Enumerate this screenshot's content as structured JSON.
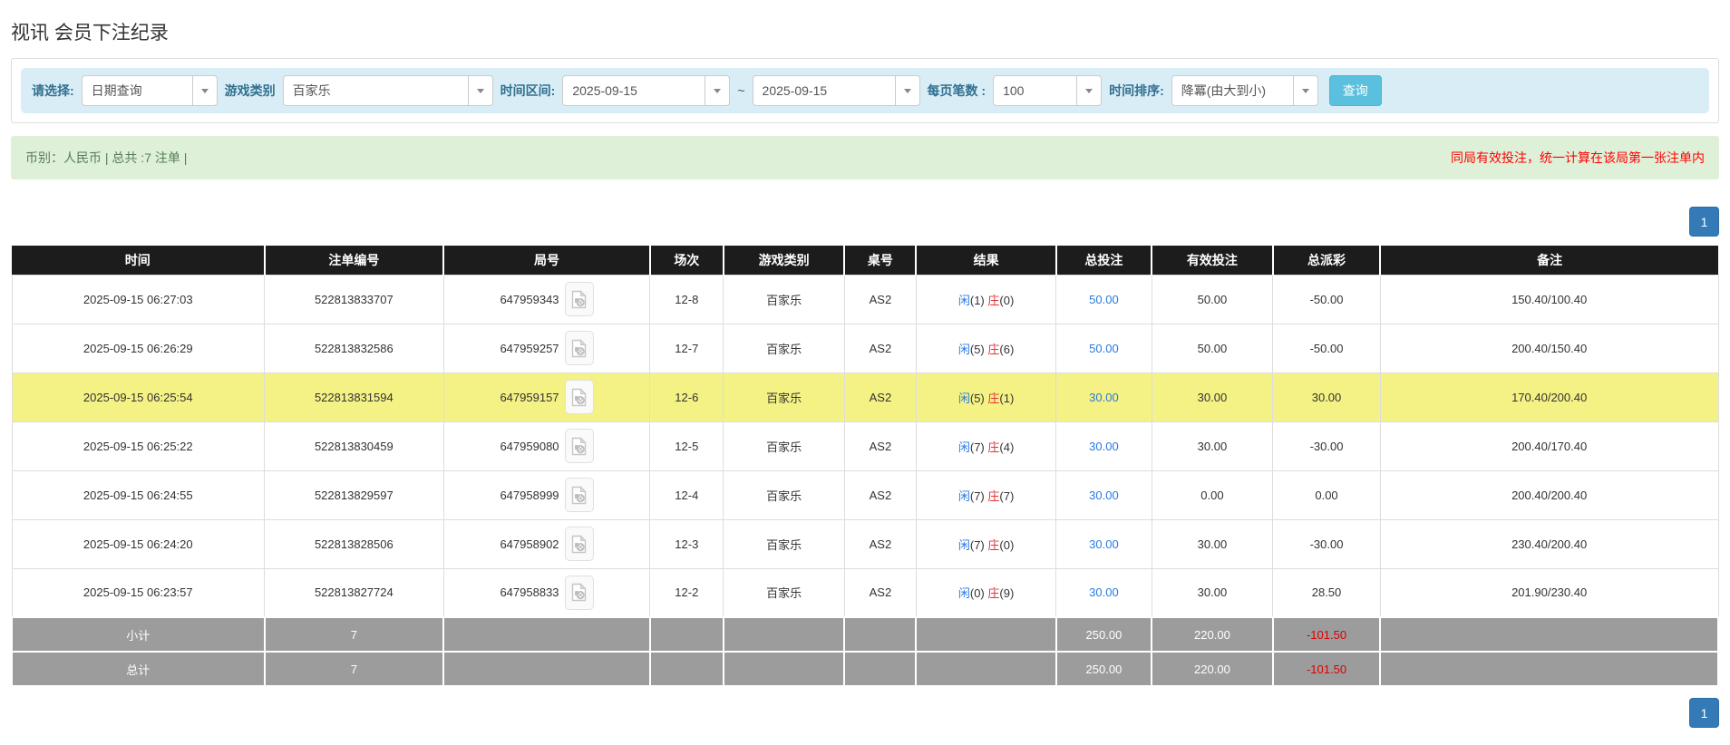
{
  "page": {
    "title": "视讯 会员下注纪录"
  },
  "filters": {
    "query_type": {
      "label": "请选择:",
      "value": "日期查询"
    },
    "game_category": {
      "label": "游戏类别",
      "value": "百家乐"
    },
    "time_range": {
      "label": "时间区间:",
      "from": "2025-09-15",
      "tilde": "~",
      "to": "2025-09-15"
    },
    "page_size": {
      "label": "每页笔数 :",
      "value": "100"
    },
    "time_sort": {
      "label": "时间排序:",
      "value": "降冪(由大到小)"
    },
    "search_button": "查询"
  },
  "summary": {
    "left": "币别：人民币 | 总共 :7 注单 |",
    "right_notice": "同局有效投注，统一计算在该局第一张注单内"
  },
  "pagination": {
    "current_page": "1"
  },
  "table": {
    "headers": [
      "时间",
      "注单编号",
      "局号",
      "场次",
      "游戏类别",
      "桌号",
      "结果",
      "总投注",
      "有效投注",
      "总派彩",
      "备注"
    ],
    "rows": [
      {
        "time": "2025-09-15 06:27:03",
        "bet_id": "522813833707",
        "round_id": "647959343",
        "session": "12-8",
        "game": "百家乐",
        "table_no": "AS2",
        "player_label": "闲",
        "player_value": "(1)",
        "banker_label": "庄",
        "banker_value": "(0)",
        "total_bet": "50.00",
        "valid_bet": "50.00",
        "payout": "-50.00",
        "remark": "150.40/100.40",
        "highlight": false
      },
      {
        "time": "2025-09-15 06:26:29",
        "bet_id": "522813832586",
        "round_id": "647959257",
        "session": "12-7",
        "game": "百家乐",
        "table_no": "AS2",
        "player_label": "闲",
        "player_value": "(5)",
        "banker_label": "庄",
        "banker_value": "(6)",
        "total_bet": "50.00",
        "valid_bet": "50.00",
        "payout": "-50.00",
        "remark": "200.40/150.40",
        "highlight": false
      },
      {
        "time": "2025-09-15 06:25:54",
        "bet_id": "522813831594",
        "round_id": "647959157",
        "session": "12-6",
        "game": "百家乐",
        "table_no": "AS2",
        "player_label": "闲",
        "player_value": "(5)",
        "banker_label": "庄",
        "banker_value": "(1)",
        "total_bet": "30.00",
        "valid_bet": "30.00",
        "payout": "30.00",
        "remark": "170.40/200.40",
        "highlight": true
      },
      {
        "time": "2025-09-15 06:25:22",
        "bet_id": "522813830459",
        "round_id": "647959080",
        "session": "12-5",
        "game": "百家乐",
        "table_no": "AS2",
        "player_label": "闲",
        "player_value": "(7)",
        "banker_label": "庄",
        "banker_value": "(4)",
        "total_bet": "30.00",
        "valid_bet": "30.00",
        "payout": "-30.00",
        "remark": "200.40/170.40",
        "highlight": false
      },
      {
        "time": "2025-09-15 06:24:55",
        "bet_id": "522813829597",
        "round_id": "647958999",
        "session": "12-4",
        "game": "百家乐",
        "table_no": "AS2",
        "player_label": "闲",
        "player_value": "(7)",
        "banker_label": "庄",
        "banker_value": "(7)",
        "total_bet": "30.00",
        "valid_bet": "0.00",
        "payout": "0.00",
        "remark": "200.40/200.40",
        "highlight": false
      },
      {
        "time": "2025-09-15 06:24:20",
        "bet_id": "522813828506",
        "round_id": "647958902",
        "session": "12-3",
        "game": "百家乐",
        "table_no": "AS2",
        "player_label": "闲",
        "player_value": "(7)",
        "banker_label": "庄",
        "banker_value": "(0)",
        "total_bet": "30.00",
        "valid_bet": "30.00",
        "payout": "-30.00",
        "remark": "230.40/200.40",
        "highlight": false
      },
      {
        "time": "2025-09-15 06:23:57",
        "bet_id": "522813827724",
        "round_id": "647958833",
        "session": "12-2",
        "game": "百家乐",
        "table_no": "AS2",
        "player_label": "闲",
        "player_value": "(0)",
        "banker_label": "庄",
        "banker_value": "(9)",
        "total_bet": "30.00",
        "valid_bet": "30.00",
        "payout": "28.50",
        "remark": "201.90/230.40",
        "highlight": false
      }
    ],
    "subtotal": {
      "label": "小计",
      "count": "7",
      "total_bet": "250.00",
      "valid_bet": "220.00",
      "payout": "-101.50"
    },
    "total": {
      "label": "总计",
      "count": "7",
      "total_bet": "250.00",
      "valid_bet": "220.00",
      "payout": "-101.50"
    }
  },
  "colors": {
    "accent_blue": "#2a7ae2",
    "banker_red": "#e53333",
    "negative_red": "#ee0000",
    "filter_bg": "#d9edf7",
    "summary_bg": "#dff0d8",
    "header_bg": "#1c1c1c",
    "highlight_yellow": "#f4f284",
    "summary_row_gray": "#9c9c9c",
    "pager_blue": "#337ab7",
    "search_btn_blue": "#5bc0de"
  }
}
